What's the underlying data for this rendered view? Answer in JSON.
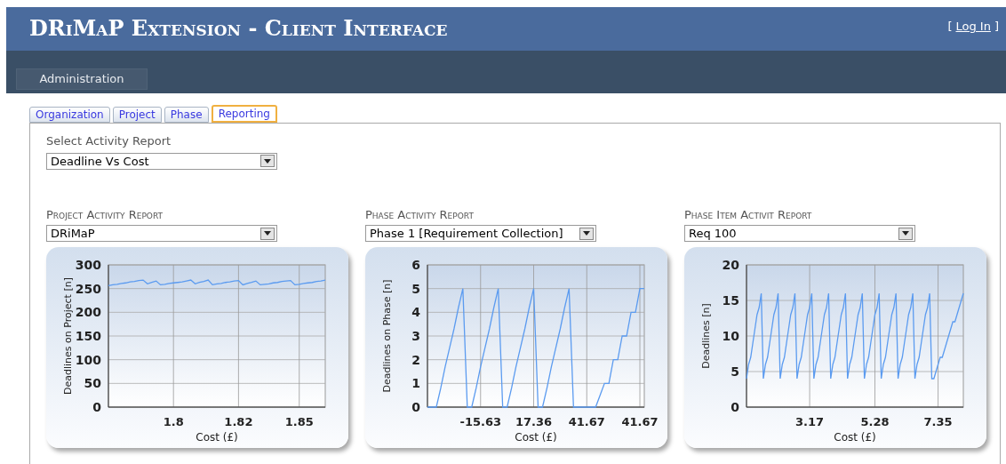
{
  "header": {
    "title": "DRiMaP Extension - Client Interface",
    "login": {
      "open": "[",
      "link": "Log In",
      "close": "]"
    }
  },
  "nav": {
    "items": [
      {
        "label": "Administration",
        "selected": true
      }
    ]
  },
  "tabs": [
    {
      "label": "Organization",
      "selected": false
    },
    {
      "label": "Project",
      "selected": false
    },
    {
      "label": "Phase",
      "selected": false
    },
    {
      "label": "Reporting",
      "selected": true
    }
  ],
  "select_report": {
    "label": "Select Activity Report",
    "value": "Deadline Vs Cost"
  },
  "reports": [
    {
      "label": "Project Activity Report",
      "value": "DRiMaP",
      "chart_data": {
        "type": "line",
        "xlabel": "Cost (£)",
        "ylabel": "Deadlines on Project [n]",
        "categories": [
          null,
          null,
          null,
          null,
          null,
          null,
          null,
          null,
          null,
          null,
          null,
          null,
          null,
          null,
          null,
          "1.8",
          null,
          null,
          null,
          null,
          null,
          null,
          null,
          null,
          null,
          null,
          null,
          null,
          null,
          null,
          "1.82",
          null,
          null,
          null,
          null,
          null,
          null,
          null,
          null,
          null,
          null,
          null,
          null,
          null,
          "1.85",
          null,
          null,
          null,
          null,
          null,
          null
        ],
        "series": [
          {
            "color": "#5b9bf0",
            "values": [
              256,
              258,
              259,
              261,
              262,
              264,
              265,
              267,
              268,
              260,
              263,
              266,
              258,
              259,
              261,
              262,
              263,
              264,
              266,
              268,
              260,
              263,
              265,
              268,
              258,
              260,
              261,
              263,
              264,
              266,
              267,
              258,
              261,
              263,
              266,
              258,
              259,
              260,
              262,
              263,
              265,
              266,
              267,
              258,
              259,
              261,
              262,
              263,
              265,
              266,
              268
            ]
          }
        ],
        "grid": true,
        "ylim": [
          0,
          300
        ],
        "yticks": [
          0,
          50,
          100,
          150,
          200,
          250,
          300
        ]
      }
    },
    {
      "label": "Phase Activity Report",
      "value": "Phase 1 [Requirement Collection]",
      "chart_data": {
        "type": "line",
        "xlabel": "Cost (£)",
        "ylabel": "Deadlines on Phase [n]",
        "categories": [
          null,
          null,
          null,
          null,
          null,
          null,
          null,
          null,
          null,
          null,
          null,
          null,
          "-15.63",
          null,
          null,
          null,
          null,
          null,
          null,
          null,
          null,
          null,
          null,
          null,
          "17.36",
          null,
          null,
          null,
          null,
          null,
          null,
          null,
          null,
          null,
          null,
          null,
          "41.67",
          null,
          null,
          null,
          null,
          null,
          null,
          null,
          null,
          null,
          null,
          null,
          "41.67",
          null
        ],
        "series": [
          {
            "color": "#5b9bf0",
            "values": [
              0,
              0,
              0,
              0.8,
              1.7,
              2.5,
              3.3,
              4.2,
              5,
              0,
              0,
              0.8,
              1.7,
              2.5,
              3.3,
              4.2,
              5,
              0,
              0,
              0.8,
              1.7,
              2.5,
              3.3,
              4.2,
              5,
              0,
              0,
              0.8,
              1.7,
              2.5,
              3.3,
              4.2,
              5,
              0,
              0,
              0,
              0,
              0,
              0,
              0.5,
              1,
              1,
              2,
              2,
              3,
              3,
              4,
              4,
              5,
              5
            ]
          }
        ],
        "grid": true,
        "ylim": [
          0,
          6
        ],
        "yticks": [
          0,
          1,
          2,
          3,
          4,
          5,
          6
        ]
      }
    },
    {
      "label": "Phase Item Activit Report",
      "value": "Req 100",
      "chart_data": {
        "type": "line",
        "xlabel": "Cost (£)",
        "ylabel": "Deadlines [n]",
        "categories": [
          null,
          null,
          null,
          null,
          null,
          null,
          null,
          null,
          null,
          null,
          null,
          null,
          null,
          null,
          null,
          null,
          null,
          null,
          null,
          null,
          null,
          null,
          null,
          null,
          null,
          null,
          null,
          null,
          null,
          null,
          "3.17",
          null,
          null,
          null,
          null,
          null,
          null,
          null,
          null,
          null,
          null,
          null,
          null,
          null,
          null,
          null,
          null,
          null,
          null,
          null,
          null,
          null,
          null,
          null,
          null,
          null,
          null,
          null,
          null,
          null,
          null,
          "5.28",
          null,
          null,
          null,
          null,
          null,
          null,
          null,
          null,
          null,
          null,
          null,
          null,
          null,
          null,
          null,
          null,
          null,
          null,
          null,
          null,
          null,
          null,
          null,
          null,
          null,
          null,
          null,
          null,
          null,
          "7.35",
          null,
          null,
          null,
          null,
          null,
          null,
          null,
          null,
          null,
          null,
          null,
          null
        ],
        "series": [
          {
            "color": "#5b9bf0",
            "values": [
              4,
              6,
              7,
              9,
              11,
              13,
              14,
              16,
              4,
              6,
              7,
              9,
              11,
              13,
              14,
              16,
              4,
              6,
              7,
              9,
              11,
              13,
              14,
              16,
              4,
              6,
              7,
              9,
              11,
              13,
              14,
              16,
              4,
              6,
              7,
              9,
              11,
              13,
              14,
              16,
              4,
              6,
              7,
              9,
              11,
              13,
              14,
              16,
              4,
              6,
              7,
              9,
              11,
              13,
              14,
              16,
              4,
              6,
              7,
              9,
              11,
              13,
              14,
              16,
              4,
              6,
              7,
              9,
              11,
              13,
              14,
              16,
              4,
              6,
              7,
              9,
              11,
              13,
              14,
              16,
              4,
              6,
              7,
              9,
              11,
              13,
              14,
              16,
              4,
              4,
              5,
              6,
              7,
              7,
              8,
              9,
              10,
              11,
              12,
              12,
              13,
              14,
              15,
              16
            ]
          }
        ],
        "grid": true,
        "ylim": [
          0,
          20
        ],
        "yticks": [
          0,
          5,
          10,
          15,
          20
        ]
      }
    }
  ]
}
